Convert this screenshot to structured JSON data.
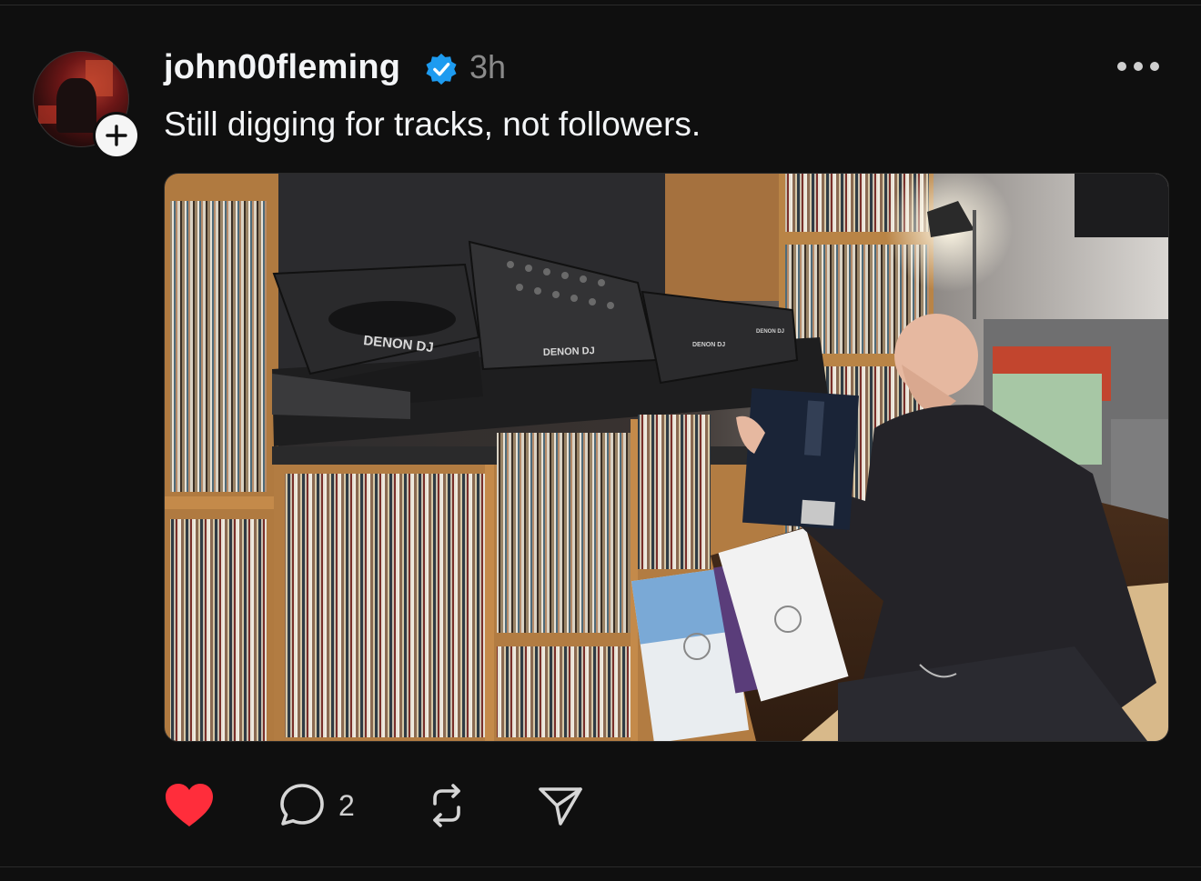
{
  "post": {
    "username": "john00fleming",
    "time": "3h",
    "caption": "Still digging for tracks, not followers.",
    "media_text": {
      "deck_left": "DENON DJ",
      "mixer": "DENON DJ",
      "deck_small_a": "DENON DJ",
      "deck_small_b": "DENON DJ"
    },
    "actions": {
      "comment_count": "2"
    }
  },
  "colors": {
    "like_red": "#ff2d3b",
    "verified_blue": "#1d9bf0",
    "muted": "#8a8a8a",
    "background": "#0f0f0f"
  },
  "icons": {
    "avatar": "avatar",
    "follow": "plus-icon",
    "verified": "verified-badge-icon",
    "more": "more-options-icon",
    "like": "heart-icon",
    "comment": "comment-icon",
    "repost": "repost-icon",
    "share": "send-icon"
  }
}
